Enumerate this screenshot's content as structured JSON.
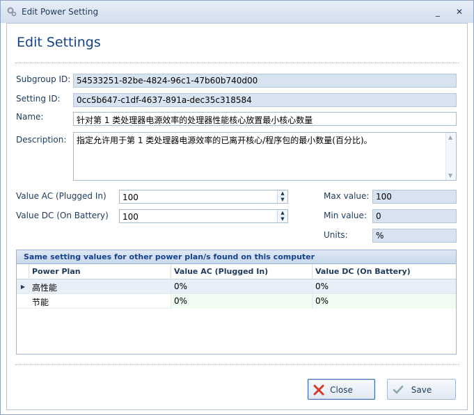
{
  "window": {
    "title": "Edit Power Setting",
    "minimize_glyph": "_",
    "close_glyph": "✕"
  },
  "heading": "Edit Settings",
  "fields": {
    "subgroup_id": {
      "label": "Subgroup ID:",
      "value": "54533251-82be-4824-96c1-47b60b740d00"
    },
    "setting_id": {
      "label": "Setting ID:",
      "value": "0cc5b647-c1df-4637-891a-dec35c318584"
    },
    "name": {
      "label": "Name:",
      "value": "针对第 1 类处理器电源效率的处理器性能核心放置最小核心数量"
    },
    "description": {
      "label": "Description:",
      "value": "指定允许用于第 1 类处理器电源效率的已离开核心/程序包的最小数量(百分比)。"
    },
    "value_ac": {
      "label": "Value AC (Plugged In)",
      "value": "100"
    },
    "value_dc": {
      "label": "Value DC (On Battery)",
      "value": "100"
    },
    "max_value": {
      "label": "Max value:",
      "value": "100"
    },
    "min_value": {
      "label": "Min value:",
      "value": "0"
    },
    "units": {
      "label": "Units:",
      "value": "%"
    }
  },
  "grid": {
    "caption": "Same setting values for other power plan/s found on this computer",
    "columns": [
      "Power Plan",
      "Value AC (Plugged In)",
      "Value DC (On Battery)"
    ],
    "rows": [
      {
        "plan": "高性能",
        "ac": "0%",
        "dc": "0%"
      },
      {
        "plan": "节能",
        "ac": "0%",
        "dc": "0%"
      }
    ]
  },
  "buttons": {
    "close": "Close",
    "save": "Save"
  },
  "icons": {
    "title": "gears-icon",
    "close": "red-x-icon",
    "save": "green-check-icon"
  }
}
